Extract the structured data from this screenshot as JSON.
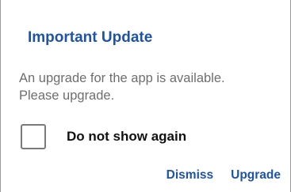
{
  "dialog": {
    "title": "Important Update",
    "message_line1": "An upgrade for the app is available.",
    "message_line2": "Please upgrade.",
    "checkbox_label": "Do not show again",
    "checkbox_checked": false,
    "dismiss_label": "Dismiss",
    "upgrade_label": "Upgrade"
  },
  "colors": {
    "accent": "#1f53a6",
    "message_text": "#6e6e6e",
    "label_text": "#111111",
    "background": "#ffffff"
  }
}
